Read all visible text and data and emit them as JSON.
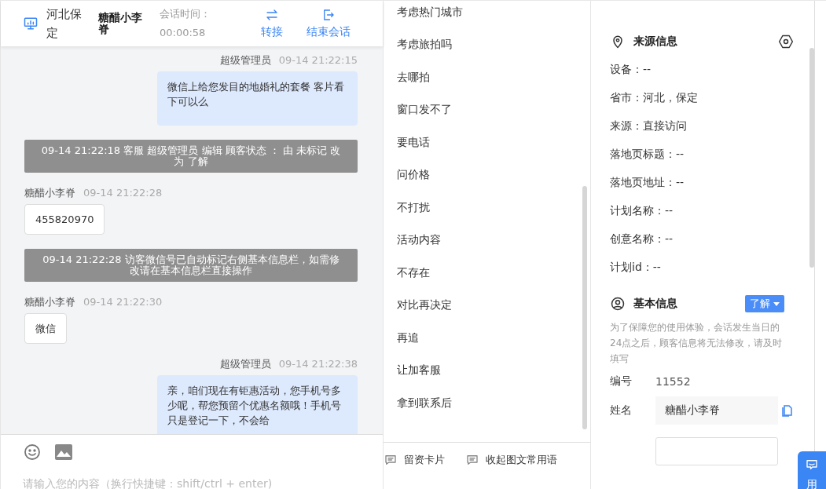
{
  "header": {
    "location": "河北保定",
    "visitor_name": "糖醋小李脊",
    "session_time_label": "会话时间：",
    "session_time": "00:00:58",
    "actions": [
      {
        "kind": "transfer",
        "label": "转接"
      },
      {
        "kind": "end",
        "label": "结束会话"
      }
    ]
  },
  "messages": [
    {
      "kind": "agent",
      "sender": "超级管理员",
      "time": "09-14 21:22:15",
      "text": "微信上给您发目的地婚礼的套餐 客片看下可以么"
    },
    {
      "kind": "system",
      "text": "09-14 21:22:18 客服 超级管理员 编辑 顾客状态 ： 由 未标记 改为 了解"
    },
    {
      "kind": "visitor",
      "sender": "糖醋小李脊",
      "time": "09-14 21:22:28",
      "text": "455820970"
    },
    {
      "kind": "system",
      "text": "09-14 21:22:28 访客微信号已自动标记右侧基本信息栏，如需修改请在基本信息栏直接操作"
    },
    {
      "kind": "visitor",
      "sender": "糖醋小李脊",
      "time": "09-14 21:22:30",
      "text": "微信"
    },
    {
      "kind": "agent",
      "sender": "超级管理员",
      "time": "09-14 21:22:38",
      "text": "亲，咱们现在有钜惠活动，您手机号多少呢，帮您预留个优惠名额哦！手机号只是登记一下，不会给"
    }
  ],
  "composer": {
    "placeholder": "请输入您的内容（换行快捷键：shift/ctrl + enter)"
  },
  "quick_replies": [
    "考虑热门城市",
    "考虑旅拍吗",
    "去哪拍",
    "窗口发不了",
    "要电话",
    "问价格",
    "不打扰",
    "活动内容",
    "不存在",
    "对比再决定",
    "再追",
    "让加客服",
    "拿到联系后"
  ],
  "quick_actions": [
    {
      "label": "留资卡片"
    },
    {
      "label": "收起图文常用语"
    }
  ],
  "source_info": {
    "title": "来源信息",
    "rows": [
      "设备：--",
      "省市：河北，保定",
      "来源：直接访问",
      "落地页标题：--",
      "落地页地址：--",
      "计划名称：--",
      "创意名称：--",
      "计划id：--"
    ]
  },
  "basic_info": {
    "title": "基本信息",
    "status": "了解",
    "notice": "为了保障您的使用体验，会话发生当日的24点之后，顾客信息将无法修改，请及时填写",
    "fields": [
      {
        "kind": "text",
        "label": "编号",
        "value": "11552"
      },
      {
        "kind": "field",
        "label": "姓名",
        "value": "糖醋小李脊"
      }
    ]
  },
  "side_tab": {
    "label": "用"
  }
}
